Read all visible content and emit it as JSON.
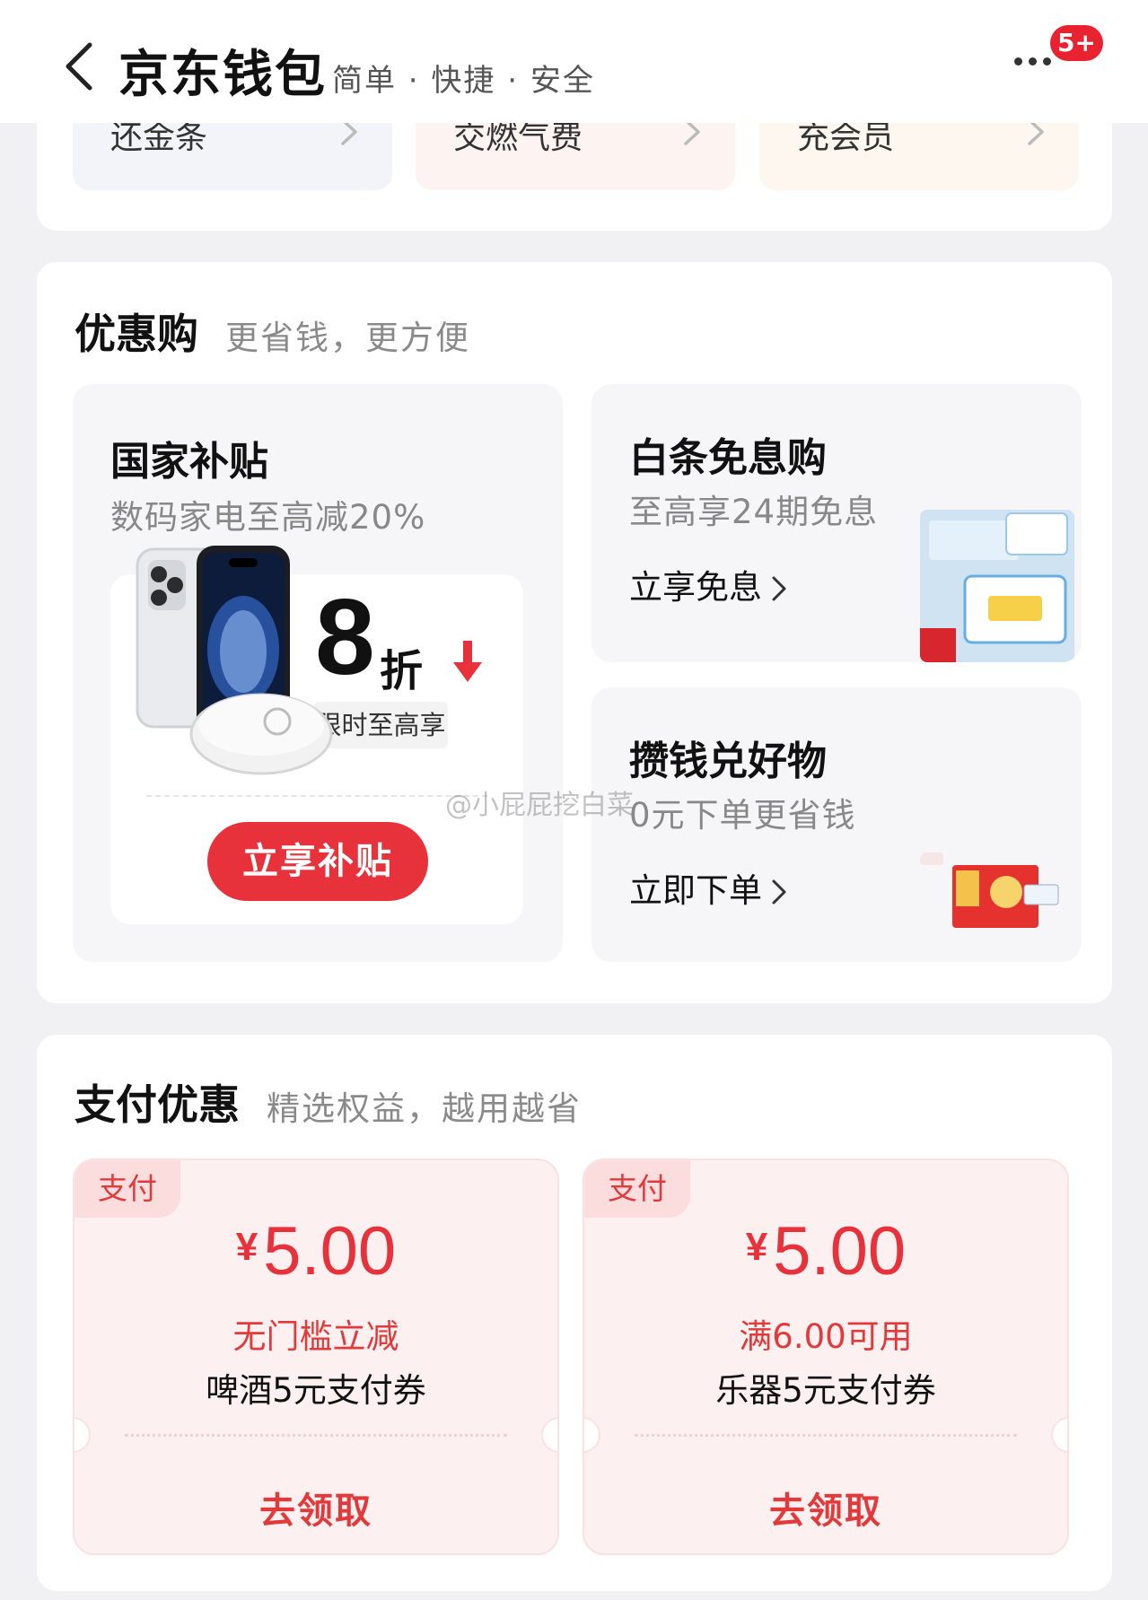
{
  "header": {
    "title": "京东钱包",
    "slogan": "简单 · 快捷 · 安全",
    "badge": "5+"
  },
  "quick_actions": [
    {
      "label": "还金条"
    },
    {
      "label": "交燃气费"
    },
    {
      "label": "充会员"
    }
  ],
  "deals": {
    "title": "优惠购",
    "subtitle": "更省钱，更方便",
    "subsidy": {
      "title": "国家补贴",
      "subtitle": "数码家电至高减20%",
      "discount_number": "8",
      "discount_unit": "折",
      "limit_text": "限时至高享",
      "cta": "立享补贴"
    },
    "interest_free": {
      "title": "白条免息购",
      "subtitle": "至高享24期免息",
      "link": "立享免息"
    },
    "save_points": {
      "title": "攒钱兑好物",
      "subtitle": "0元下单更省钱",
      "link": "立即下单"
    }
  },
  "watermark": "@小屁屁挖白菜",
  "payment": {
    "title": "支付优惠",
    "subtitle": "精选权益，越用越省",
    "coupons": [
      {
        "tag": "支付",
        "currency": "¥",
        "amount": "5.00",
        "condition": "无门槛立减",
        "name": "啤酒5元支付券",
        "action": "去领取"
      },
      {
        "tag": "支付",
        "currency": "¥",
        "amount": "5.00",
        "condition": "满6.00可用",
        "name": "乐器5元支付券",
        "action": "去领取"
      }
    ]
  },
  "colors": {
    "accent": "#e8323b",
    "background": "#f1f1f4"
  }
}
